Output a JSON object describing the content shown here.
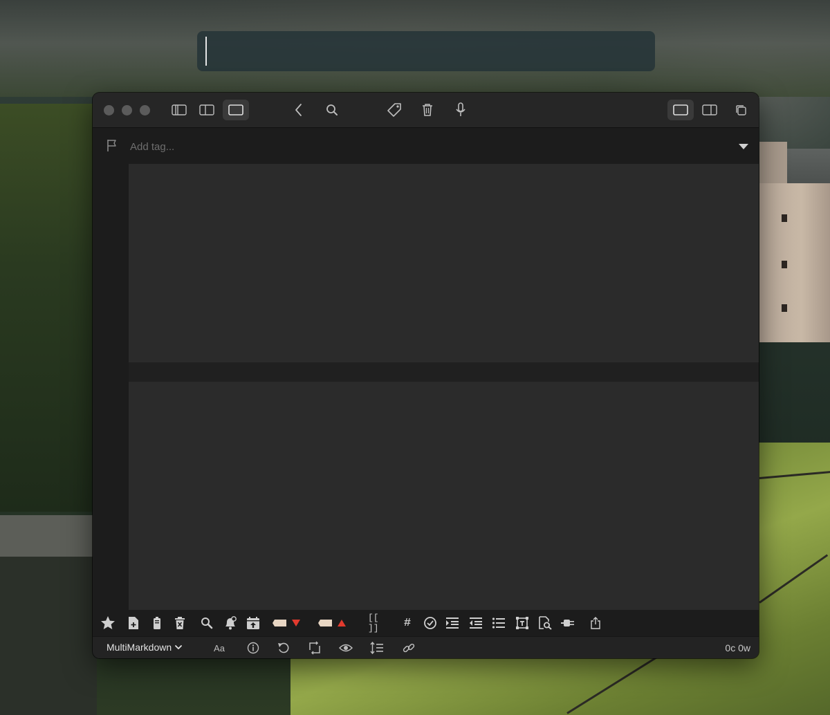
{
  "titlebar": {
    "left_icons": [
      "sidebar-three-pane-icon",
      "sidebar-two-pane-icon",
      "single-pane-icon"
    ],
    "nav_icons": [
      "back-chevron-icon",
      "search-icon"
    ],
    "action_icons": [
      "tag-icon",
      "trash-icon",
      "microphone-icon"
    ],
    "right_icons": [
      "single-pane-icon",
      "split-pane-icon",
      "float-window-icon"
    ]
  },
  "tagbar": {
    "placeholder": "Add tag..."
  },
  "toolbar": {
    "icons": [
      "star-icon",
      "new-note-icon",
      "battery-icon",
      "delete-note-icon",
      "search-icon",
      "bell-icon",
      "calendar-icon",
      "tag-down-icon",
      "tag-up-icon",
      "wikilink-icon",
      "hashtag-icon",
      "checkmark-icon",
      "indent-icon",
      "outdent-icon",
      "bullet-list-icon",
      "text-box-icon",
      "find-doc-icon",
      "plugin-icon",
      "share-icon"
    ],
    "wikilink_label": "[[ ]]",
    "hashtag_label": "#",
    "accent_red": "#e23a2e",
    "tag_color": "#e8d6c3"
  },
  "statusbar": {
    "mode": "MultiMarkdown",
    "font_label": "Aa",
    "counts": "0c 0w",
    "icons": [
      "info-icon",
      "undo-icon",
      "sync-icon",
      "eye-icon",
      "line-spacing-icon",
      "link-icon"
    ]
  }
}
